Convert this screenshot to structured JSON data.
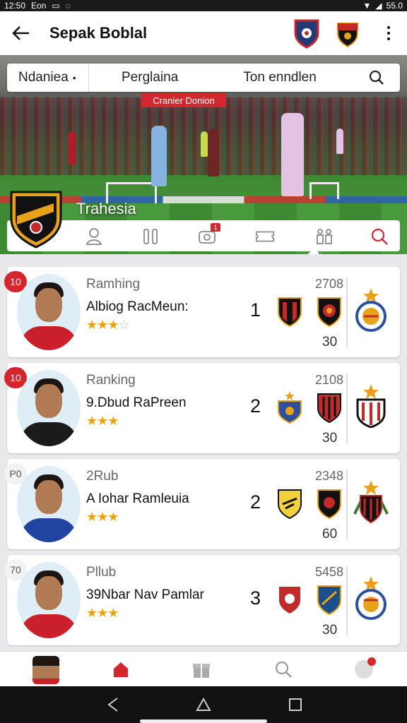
{
  "status_bar": {
    "time": "12:50",
    "carrier": "Eon",
    "battery": "55.0"
  },
  "app_bar": {
    "title": "Sepak Boblal",
    "back_icon": "arrow-left-icon",
    "more_icon": "more-vertical-icon"
  },
  "hero": {
    "tabs": [
      "Ndaniea",
      "Perglaina",
      "Ton enndlen"
    ],
    "active_tab_marker": "•",
    "banner": "Cranier Donion",
    "team_name": "Trahesia",
    "tab_icons": [
      "person-icon",
      "columns-icon",
      "camera-icon",
      "ticket-icon",
      "figure-icon",
      "search-icon"
    ],
    "notif_count": "1"
  },
  "cards": [
    {
      "badge": "10",
      "badge_style": "red",
      "category": "Ramhing",
      "name": "Albiog RacMeun:",
      "stars": 2.5,
      "rank": "1",
      "top_value": "2708",
      "bottom_value": "30",
      "shirt": "#c9202c"
    },
    {
      "badge": "10",
      "badge_style": "red",
      "category": "Ranking",
      "name": "9.Dbud RaPreen",
      "stars": 3,
      "rank": "2",
      "top_value": "2108",
      "bottom_value": "30",
      "shirt": "#1b1b1b"
    },
    {
      "badge": "P0",
      "badge_style": "plain",
      "category": "2Rub",
      "name": "A Iohar Ramleuia",
      "stars": 3,
      "rank": "2",
      "top_value": "2348",
      "bottom_value": "60",
      "shirt": "#2244a0"
    },
    {
      "badge": "70",
      "badge_style": "plain",
      "category": "Pllub",
      "name": "39Nbar Nav Pamlar",
      "stars": 3,
      "rank": "3",
      "top_value": "5458",
      "bottom_value": "30",
      "shirt": "#c9202c"
    }
  ],
  "bottom_nav": [
    "profile-avatar",
    "home-icon",
    "gift-icon",
    "search-icon",
    "notification-icon"
  ],
  "colors": {
    "accent": "#d3262e",
    "star": "#e8a21a"
  }
}
